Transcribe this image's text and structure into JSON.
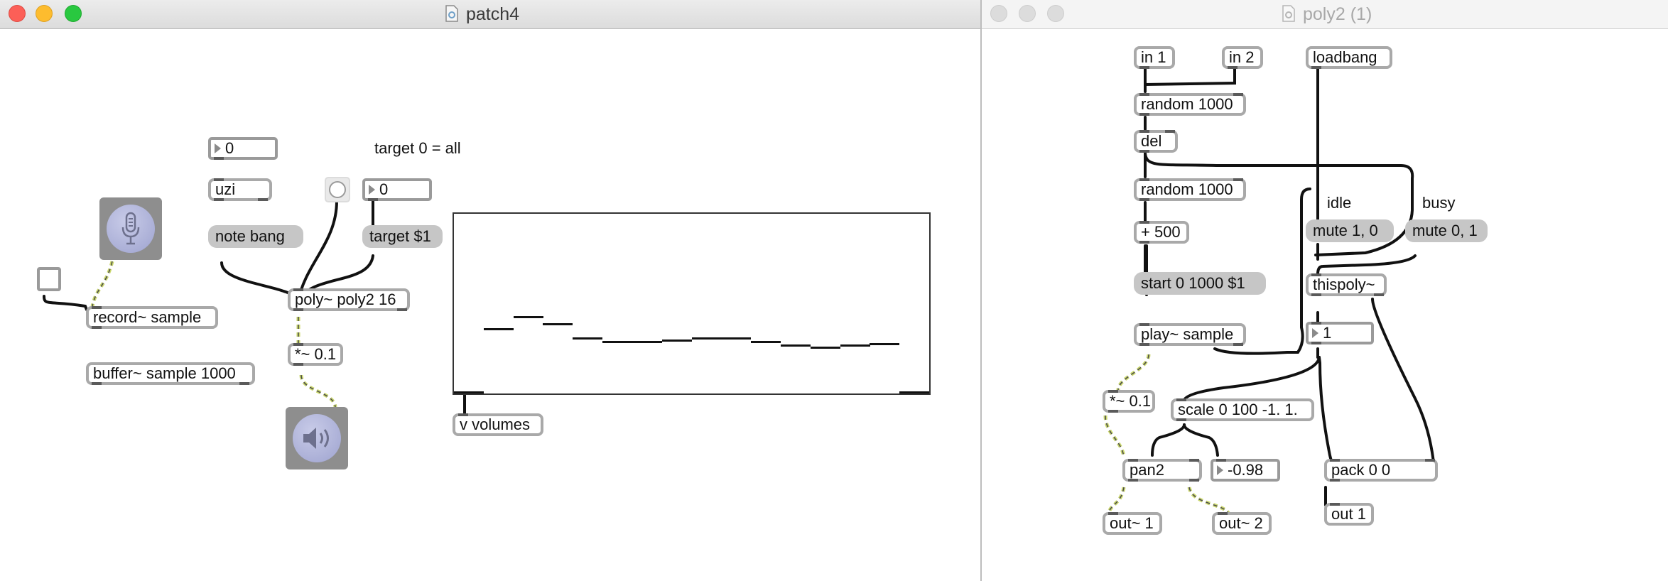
{
  "windows": {
    "patch4": {
      "title": "patch4",
      "comments": {
        "target_hint": "target 0 = all"
      },
      "objects": {
        "num_uzi_count": "0",
        "uzi": "uzi",
        "note_bang": "note bang",
        "num_target": "0",
        "target_msg": "target $1",
        "poly": "poly~ poly2 16",
        "gain": "*~ 0.1",
        "record": "record~ sample",
        "buffer": "buffer~ sample 1000",
        "v_volumes": "v volumes"
      },
      "multislider": {
        "values": [
          0.0,
          0.35,
          0.42,
          0.38,
          0.3,
          0.28,
          0.28,
          0.29,
          0.3,
          0.3,
          0.28,
          0.26,
          0.25,
          0.26,
          0.27,
          0.0
        ]
      }
    },
    "poly2": {
      "title": "poly2 (1)",
      "comments": {
        "idle": "idle",
        "busy": "busy"
      },
      "objects": {
        "in1": "in 1",
        "in2": "in 2",
        "loadbang": "loadbang",
        "random1": "random 1000",
        "del": "del",
        "random2": "random 1000",
        "plus500": "+ 500",
        "start_msg": "start 0 1000 $1",
        "play": "play~ sample",
        "mute_idle": "mute 1, 0",
        "mute_busy": "mute 0, 1",
        "thispoly": "thispoly~",
        "num_voice": "1",
        "gain": "*~ 0.1",
        "scale": "scale 0 100 -1. 1.",
        "pan2": "pan2",
        "num_pan": "-0.98",
        "pack": "pack 0 0",
        "out1_signal": "out~ 1",
        "out2_signal": "out~ 2",
        "out1": "out 1"
      }
    }
  },
  "colors": {
    "close": "#fc5f57",
    "minimize": "#fdbc2e",
    "zoom": "#29c840",
    "inactive_light": "#dcdcdc",
    "signal_cable": "#c9d66b"
  }
}
